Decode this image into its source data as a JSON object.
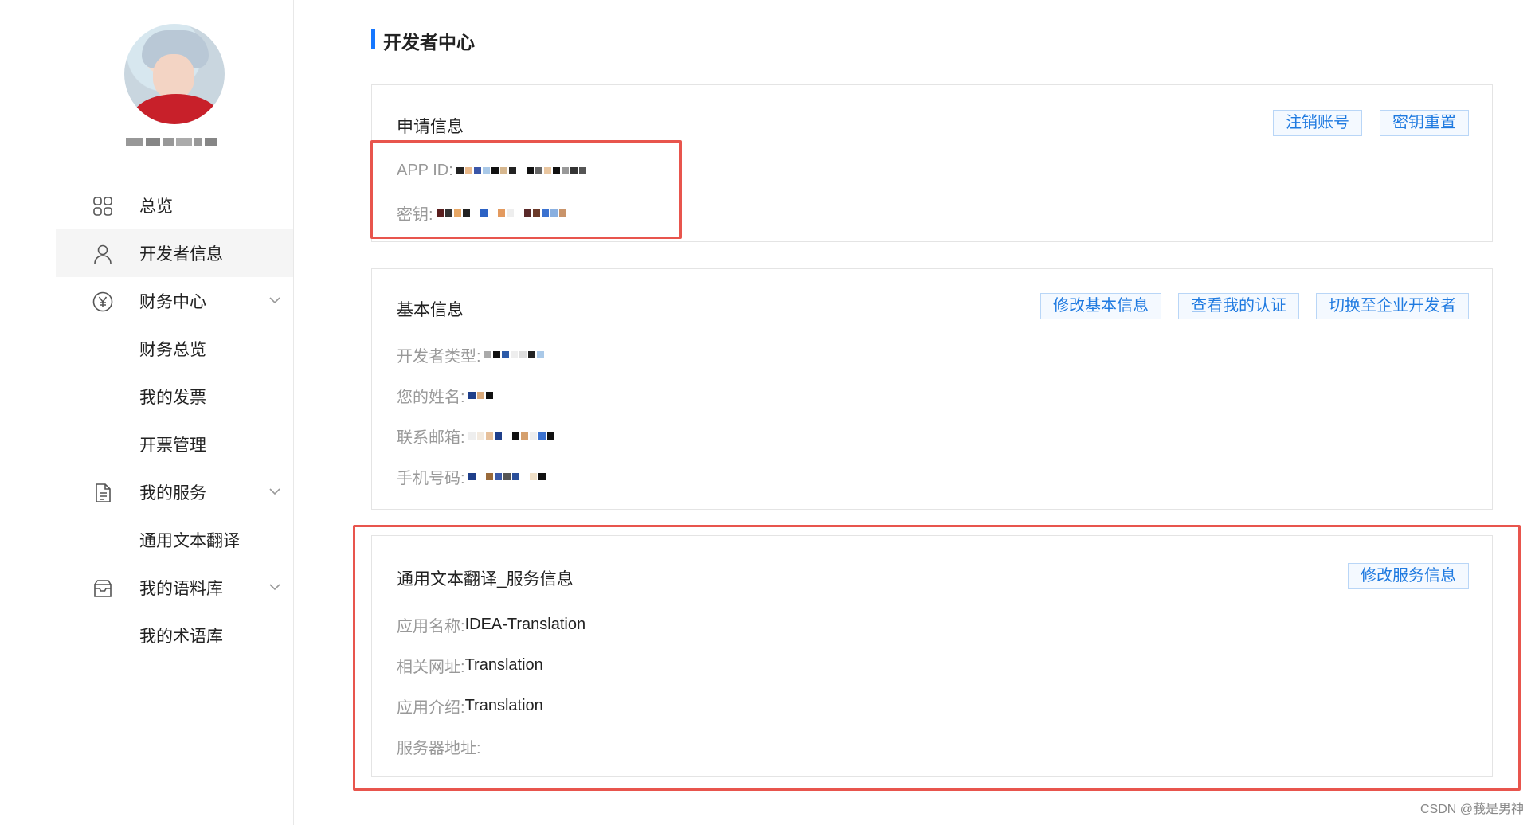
{
  "sidebar": {
    "menu": [
      {
        "label": "总览",
        "icon": "grid-icon"
      },
      {
        "label": "开发者信息",
        "icon": "user-icon",
        "active": true
      },
      {
        "label": "财务中心",
        "icon": "yen-icon",
        "expandable": true
      },
      {
        "label": "财务总览"
      },
      {
        "label": "我的发票"
      },
      {
        "label": "开票管理"
      },
      {
        "label": "我的服务",
        "icon": "document-icon",
        "expandable": true
      },
      {
        "label": "通用文本翻译"
      },
      {
        "label": "我的语料库",
        "icon": "inbox-icon",
        "expandable": true
      },
      {
        "label": "我的术语库"
      }
    ]
  },
  "main": {
    "title": "开发者中心",
    "application": {
      "title": "申请信息",
      "buttons": {
        "cancel": "注销账号",
        "reset": "密钥重置"
      },
      "app_id_label": "APP ID:",
      "secret_label": "密钥:"
    },
    "basic": {
      "title": "基本信息",
      "buttons": {
        "edit": "修改基本信息",
        "view_cert": "查看我的认证",
        "switch": "切换至企业开发者"
      },
      "fields": {
        "type": "开发者类型:",
        "name": "您的姓名:",
        "email": "联系邮箱:",
        "phone": "手机号码:"
      }
    },
    "service": {
      "title": "通用文本翻译_服务信息",
      "button": "修改服务信息",
      "fields": {
        "app_name_label": "应用名称:",
        "app_name_value": "IDEA-Translation",
        "url_label": "相关网址:",
        "url_value": "Translation",
        "intro_label": "应用介绍:",
        "intro_value": "Translation",
        "server_label": "服务器地址:"
      }
    }
  },
  "watermark": "CSDN @莪是男神",
  "colors": {
    "accent": "#1677ff",
    "highlight_box": "#e8554d",
    "button_text": "#1f7ae0"
  }
}
